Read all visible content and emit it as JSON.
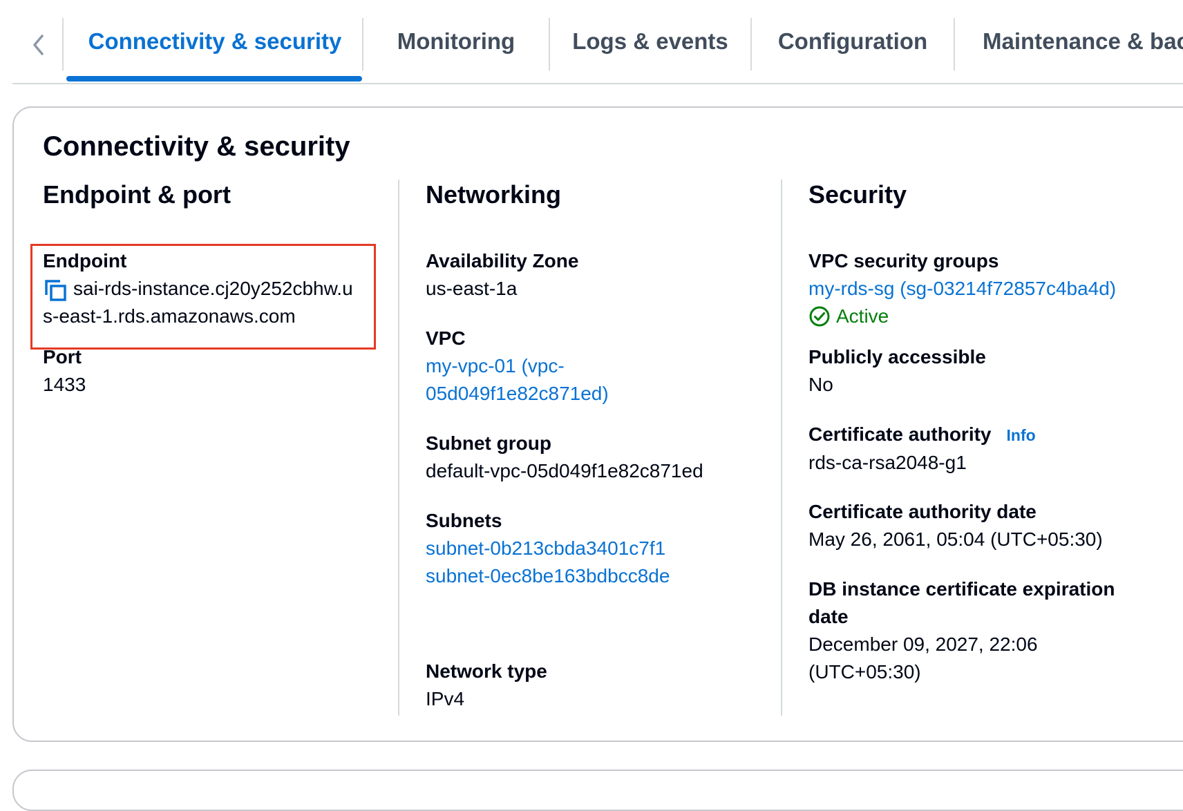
{
  "tabs": {
    "items": [
      {
        "label": "Connectivity & security",
        "active": true
      },
      {
        "label": "Monitoring",
        "active": false
      },
      {
        "label": "Logs & events",
        "active": false
      },
      {
        "label": "Configuration",
        "active": false
      },
      {
        "label": "Maintenance & backu",
        "active": false
      }
    ],
    "prev_icon": "chevron-left-icon"
  },
  "panel": {
    "title": "Connectivity & security",
    "endpoint_section": {
      "title": "Endpoint & port",
      "endpoint_label": "Endpoint",
      "endpoint_line1": "sai-rds-instance.cj20y252cbhw.u",
      "endpoint_line2": "s-east-1.rds.amazonaws.com",
      "copy_icon": "copy-icon",
      "port_label": "Port",
      "port_value": "1433"
    },
    "networking_section": {
      "title": "Networking",
      "az_label": "Availability Zone",
      "az_value": "us-east-1a",
      "vpc_label": "VPC",
      "vpc_line1": "my-vpc-01 (vpc-",
      "vpc_line2": "05d049f1e82c871ed)",
      "subnet_group_label": "Subnet group",
      "subnet_group_value": "default-vpc-05d049f1e82c871ed",
      "subnets_label": "Subnets",
      "subnets": [
        "subnet-0b213cbda3401c7f1",
        "subnet-0ec8be163bdbcc8de"
      ],
      "network_type_label": "Network type",
      "network_type_value": "IPv4"
    },
    "security_section": {
      "title": "Security",
      "sg_label": "VPC security groups",
      "sg_value": "my-rds-sg (sg-03214f72857c4ba4d)",
      "sg_status": "Active",
      "sg_status_icon": "check-circle-icon",
      "public_label": "Publicly accessible",
      "public_value": "No",
      "ca_label": "Certificate authority",
      "ca_info": "Info",
      "ca_value": "rds-ca-rsa2048-g1",
      "ca_date_label": "Certificate authority date",
      "ca_date_value": "May 26, 2061, 05:04 (UTC+05:30)",
      "expiry_label_line1": "DB instance certificate expiration",
      "expiry_label_line2": "date",
      "expiry_value_line1": "December 09, 2027, 22:06",
      "expiry_value_line2": "(UTC+05:30)"
    }
  },
  "colors": {
    "accent": "#0972d3",
    "success": "#037f0c",
    "highlight": "#e53a24"
  }
}
